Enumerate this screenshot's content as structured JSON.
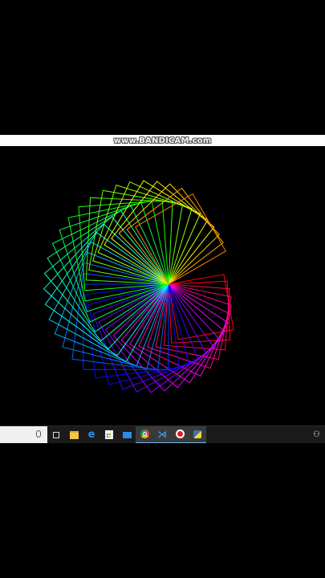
{
  "watermark": {
    "text": "www.BANDICAM.com"
  },
  "canvas": {
    "figure": "rotating-square-spiral",
    "colors": [
      "#ff0000",
      "#ff8800",
      "#ffff00",
      "#00ff00",
      "#00ffff",
      "#0000ff",
      "#ff00ff"
    ]
  },
  "taskbar": {
    "items": [
      {
        "icon": "microphone-icon"
      },
      {
        "icon": "task-view-icon"
      },
      {
        "icon": "file-explorer-icon"
      },
      {
        "icon": "edge-browser-icon"
      },
      {
        "icon": "store-icon"
      },
      {
        "icon": "mail-icon"
      },
      {
        "icon": "chrome-icon"
      },
      {
        "icon": "vscode-icon"
      },
      {
        "icon": "record-icon"
      },
      {
        "icon": "python-icon"
      }
    ],
    "tray_icon": "people-icon"
  }
}
